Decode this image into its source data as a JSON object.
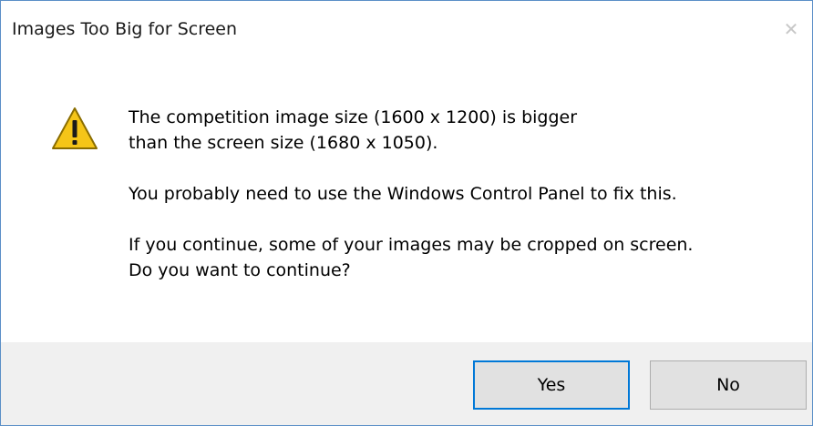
{
  "window": {
    "title": "Images Too Big for Screen",
    "close_glyph": "✕"
  },
  "icon": {
    "name": "warning-icon",
    "fill_color": "#f5c518",
    "stroke_color": "#8a6d00",
    "mark_color": "#1a1a1a"
  },
  "message": {
    "line1": "The competition image size (1600 x 1200) is bigger",
    "line2": "than the screen size (1680 x 1050).",
    "line3": "You probably need to use the Windows Control Panel to fix this.",
    "line4": "If you continue, some of your images may be cropped on screen.",
    "line5": "Do you want to continue?"
  },
  "buttons": {
    "yes_label": "Yes",
    "no_label": "No"
  },
  "colors": {
    "window_border": "#5b8fc7",
    "footer_bg": "#f0f0f0",
    "default_button_border": "#0078d7"
  }
}
